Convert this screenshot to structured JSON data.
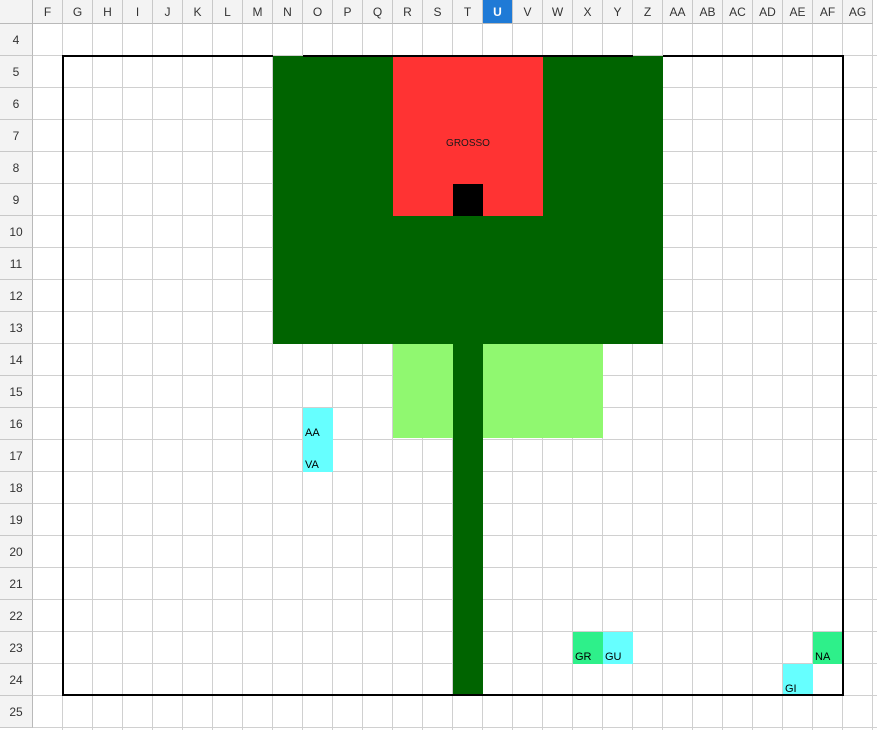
{
  "columns": [
    "F",
    "G",
    "H",
    "I",
    "J",
    "K",
    "L",
    "M",
    "N",
    "O",
    "P",
    "Q",
    "R",
    "S",
    "T",
    "U",
    "V",
    "W",
    "X",
    "Y",
    "Z",
    "AA",
    "AB",
    "AC",
    "AD",
    "AE",
    "AF",
    "AG"
  ],
  "selected_column": "U",
  "rows": [
    "4",
    "5",
    "6",
    "7",
    "8",
    "9",
    "10",
    "11",
    "12",
    "13",
    "14",
    "15",
    "16",
    "17",
    "18",
    "19",
    "20",
    "21",
    "22",
    "23",
    "24",
    "25"
  ],
  "colors": {
    "dark_green": "#006400",
    "red": "#ff3333",
    "black": "#000000",
    "light_green": "#90f870",
    "cyan": "#66ffff",
    "mint": "#2ef08a",
    "header_bg": "#f3f3f3",
    "selected_header": "#1f7ad6"
  },
  "labels": {
    "center": "GROSSO",
    "aa": "AA",
    "va": "VA",
    "gr": "GR",
    "gu": "GU",
    "na": "NA",
    "gi": "GI"
  }
}
